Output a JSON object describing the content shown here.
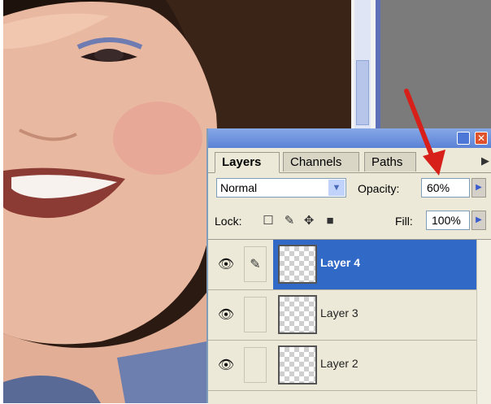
{
  "palette": {
    "tabs": [
      {
        "label": "Layers",
        "active": true
      },
      {
        "label": "Channels",
        "active": false
      },
      {
        "label": "Paths",
        "active": false
      }
    ],
    "blend_mode": "Normal",
    "opacity_label": "Opacity:",
    "opacity_value": "60%",
    "lock_label": "Lock:",
    "fill_label": "Fill:",
    "fill_value": "100%",
    "layers": [
      {
        "name": "Layer 4",
        "selected": true,
        "visible": true,
        "icon": "brush-link-icon"
      },
      {
        "name": "Layer 3",
        "selected": false,
        "visible": true
      },
      {
        "name": "Layer 2",
        "selected": false,
        "visible": true
      }
    ]
  },
  "colors": {
    "selection": "#3169c6",
    "palette_bg": "#ece9d8",
    "annotation_arrow": "#d8201a"
  }
}
